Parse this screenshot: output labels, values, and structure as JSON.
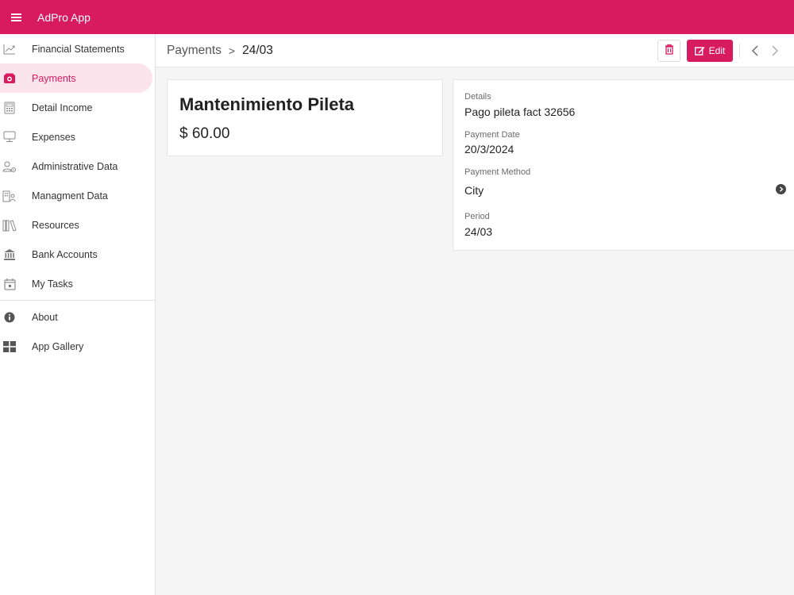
{
  "app": {
    "title": "AdPro App"
  },
  "sidebar": {
    "items": [
      {
        "label": "Financial Statements",
        "icon": "chart-line-icon"
      },
      {
        "label": "Payments",
        "icon": "payments-icon",
        "active": true
      },
      {
        "label": "Detail Income",
        "icon": "calculator-icon"
      },
      {
        "label": "Expenses",
        "icon": "monitor-icon"
      },
      {
        "label": "Administrative Data",
        "icon": "user-gear-icon"
      },
      {
        "label": "Managment Data",
        "icon": "building-user-icon"
      },
      {
        "label": "Resources",
        "icon": "books-icon"
      },
      {
        "label": "Bank Accounts",
        "icon": "bank-icon"
      },
      {
        "label": "My Tasks",
        "icon": "calendar-icon"
      }
    ],
    "footer_items": [
      {
        "label": "About",
        "icon": "info-icon"
      },
      {
        "label": "App Gallery",
        "icon": "grid-icon"
      }
    ]
  },
  "header": {
    "breadcrumb_parent": "Payments",
    "breadcrumb_separator": ">",
    "breadcrumb_current": "24/03",
    "edit_label": "Edit"
  },
  "record": {
    "name": "Mantenimiento Pileta",
    "amount": "$ 60.00"
  },
  "details": {
    "details_label": "Details",
    "details_value": "Pago pileta fact 32656",
    "payment_date_label": "Payment Date",
    "payment_date_value": "20/3/2024",
    "payment_method_label": "Payment Method",
    "payment_method_value": "City",
    "period_label": "Period",
    "period_value": "24/03"
  },
  "colors": {
    "accent": "#d81b5e",
    "active_bg": "#fbe4ec"
  }
}
